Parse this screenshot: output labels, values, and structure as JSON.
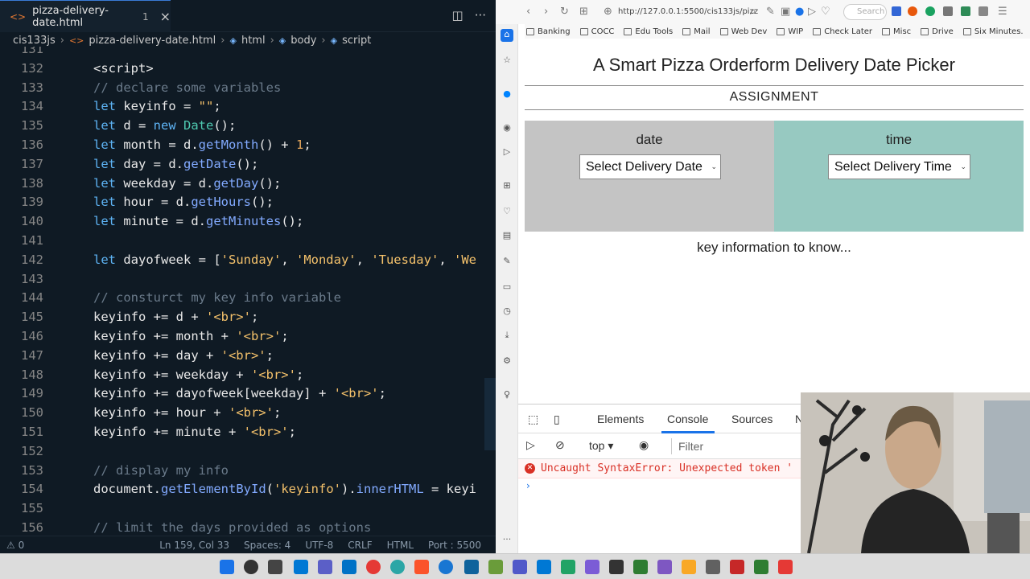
{
  "editor": {
    "tab": {
      "title": "pizza-delivery-date.html",
      "problems": "1"
    },
    "breadcrumb": [
      "cis133js",
      "pizza-delivery-date.html",
      "html",
      "body",
      "script"
    ],
    "lines": [
      {
        "n": "131",
        "t": ""
      },
      {
        "n": "132",
        "t": "<script>"
      },
      {
        "n": "133",
        "t": "// declare some variables"
      },
      {
        "n": "134",
        "t": "let keyinfo = \"\";"
      },
      {
        "n": "135",
        "t": "let d = new Date();"
      },
      {
        "n": "136",
        "t": "let month = d.getMonth() + 1;"
      },
      {
        "n": "137",
        "t": "let day = d.getDate();"
      },
      {
        "n": "138",
        "t": "let weekday = d.getDay();"
      },
      {
        "n": "139",
        "t": "let hour = d.getHours();"
      },
      {
        "n": "140",
        "t": "let minute = d.getMinutes();"
      },
      {
        "n": "141",
        "t": ""
      },
      {
        "n": "142",
        "t": "let dayofweek = ['Sunday', 'Monday', 'Tuesday', 'We"
      },
      {
        "n": "143",
        "t": ""
      },
      {
        "n": "144",
        "t": "// consturct my key info variable"
      },
      {
        "n": "145",
        "t": "keyinfo += d + '<br>';"
      },
      {
        "n": "146",
        "t": "keyinfo += month + '<br>';"
      },
      {
        "n": "147",
        "t": "keyinfo += day + '<br>';"
      },
      {
        "n": "148",
        "t": "keyinfo += weekday + '<br>';"
      },
      {
        "n": "149",
        "t": "keyinfo += dayofweek[weekday] + '<br>';"
      },
      {
        "n": "150",
        "t": "keyinfo += hour + '<br>';"
      },
      {
        "n": "151",
        "t": "keyinfo += minute + '<br>';"
      },
      {
        "n": "152",
        "t": ""
      },
      {
        "n": "153",
        "t": "// display my info"
      },
      {
        "n": "154",
        "t": "document.getElementById('keyinfo').innerHTML = keyi"
      },
      {
        "n": "155",
        "t": ""
      },
      {
        "n": "156",
        "t": "// limit the days provided as options"
      }
    ],
    "status": {
      "problems": "0",
      "position": "Ln 159, Col 33",
      "spaces": "Spaces: 4",
      "encoding": "UTF-8",
      "eol": "CRLF",
      "language": "HTML",
      "port": "Port : 5500"
    }
  },
  "browser": {
    "url": "http://127.0.0.1:5500/cis133js/pizz",
    "search_placeholder": "Search",
    "bookmarks": [
      "Banking",
      "COCC",
      "Edu Tools",
      "Mail",
      "Web Dev",
      "WIP",
      "Check Later",
      "Misc",
      "Drive",
      "Six Minutes.",
      "Web Dev"
    ],
    "page": {
      "title": "A Smart Pizza Orderform Delivery Date Picker",
      "assignment": "ASSIGNMENT",
      "date_label": "date",
      "date_select": "Select Delivery Date",
      "time_label": "time",
      "time_select": "Select Delivery Time",
      "key_info": "key information to know..."
    },
    "devtools": {
      "tabs": [
        "Elements",
        "Console",
        "Sources",
        "N"
      ],
      "active_tab": "Console",
      "context": "top",
      "filter_placeholder": "Filter",
      "error": "Uncaught SyntaxError: Unexpected token '"
    }
  },
  "colors": {
    "editor_bg": "#0f1a24",
    "accent": "#1a73e8",
    "error": "#d93025",
    "date_panel": "#c4c4c4",
    "time_panel": "#97c9c1"
  }
}
